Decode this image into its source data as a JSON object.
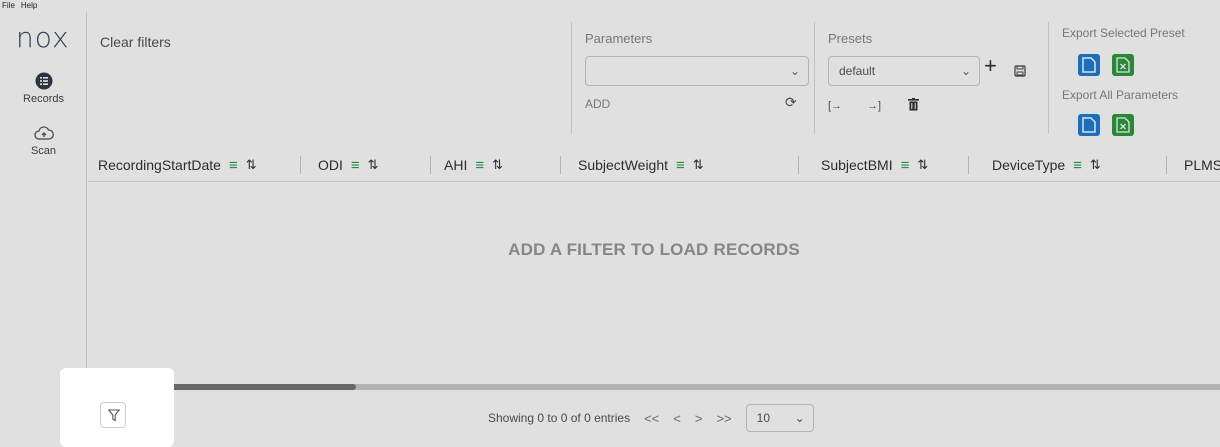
{
  "menu": {
    "file": "File",
    "help": "Help"
  },
  "logo": "nox",
  "sidebar": {
    "items": [
      {
        "label": "Records",
        "icon": "list-icon"
      },
      {
        "label": "Scan",
        "icon": "cloud-upload-icon"
      }
    ]
  },
  "toolbar": {
    "clear_filters": "Clear filters",
    "parameters_label": "Parameters",
    "parameters_value": "",
    "add_label": "ADD",
    "presets_label": "Presets",
    "presets_value": "default",
    "export_selected_label": "Export Selected Preset",
    "export_all_label": "Export All Parameters"
  },
  "table": {
    "columns": [
      "RecordingStartDate",
      "ODI",
      "AHI",
      "SubjectWeight",
      "SubjectBMI",
      "DeviceType",
      "PLMS"
    ],
    "empty_message": "ADD A FILTER TO LOAD RECORDS"
  },
  "footer": {
    "showing": "Showing 0 to 0 of 0 entries",
    "first": "<<",
    "prev": "<",
    "next": ">",
    "last": ">>",
    "page_size": "10"
  },
  "colors": {
    "accent_green": "#2e9e4f",
    "export_blue": "#1e7fd8",
    "export_green": "#2f9b3e"
  },
  "scroll_position": 0.24
}
